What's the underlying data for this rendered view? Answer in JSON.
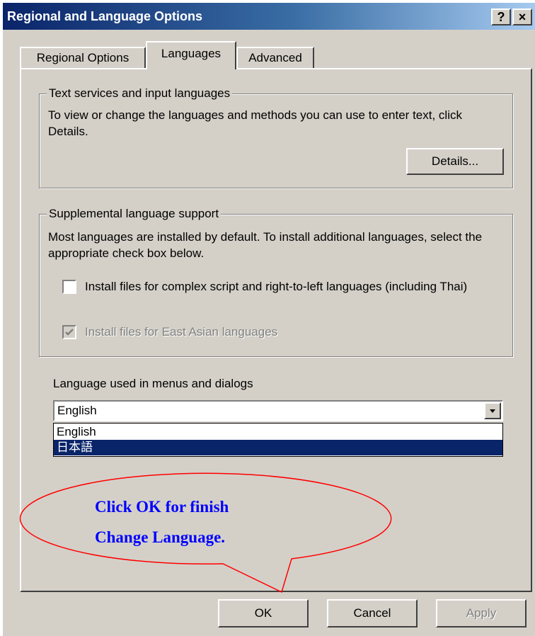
{
  "window": {
    "title": "Regional and Language Options",
    "help_button": "?",
    "close_button": "×"
  },
  "tabs": [
    {
      "label": "Regional Options"
    },
    {
      "label": "Languages",
      "active": true
    },
    {
      "label": "Advanced"
    }
  ],
  "text_services": {
    "legend": "Text services and input languages",
    "description": "To view or change the languages and methods you can use to enter text, click Details.",
    "details_button": "Details..."
  },
  "supplemental": {
    "legend": "Supplemental language support",
    "description": "Most languages are installed by default. To install additional languages, select the appropriate check box below.",
    "complex_script_label": "Install files for complex script and right-to-left languages (including Thai)",
    "complex_script_checked": false,
    "east_asian_label": "Install files for East Asian languages",
    "east_asian_checked": true,
    "east_asian_disabled": true
  },
  "ui_language": {
    "label": "Language used in menus and dialogs",
    "selected": "English",
    "options": [
      "English",
      "日本語"
    ],
    "highlighted": "日本語"
  },
  "callout": {
    "line1": "Click OK for finish",
    "line2": "Change Language."
  },
  "buttons": {
    "ok": "OK",
    "cancel": "Cancel",
    "apply": "Apply"
  },
  "colors": {
    "title_bar": "#0a246a",
    "dialog_face": "#d4d0c8",
    "selection": "#0a246a",
    "callout_outline": "#ff0000",
    "callout_text": "#0000ff"
  }
}
